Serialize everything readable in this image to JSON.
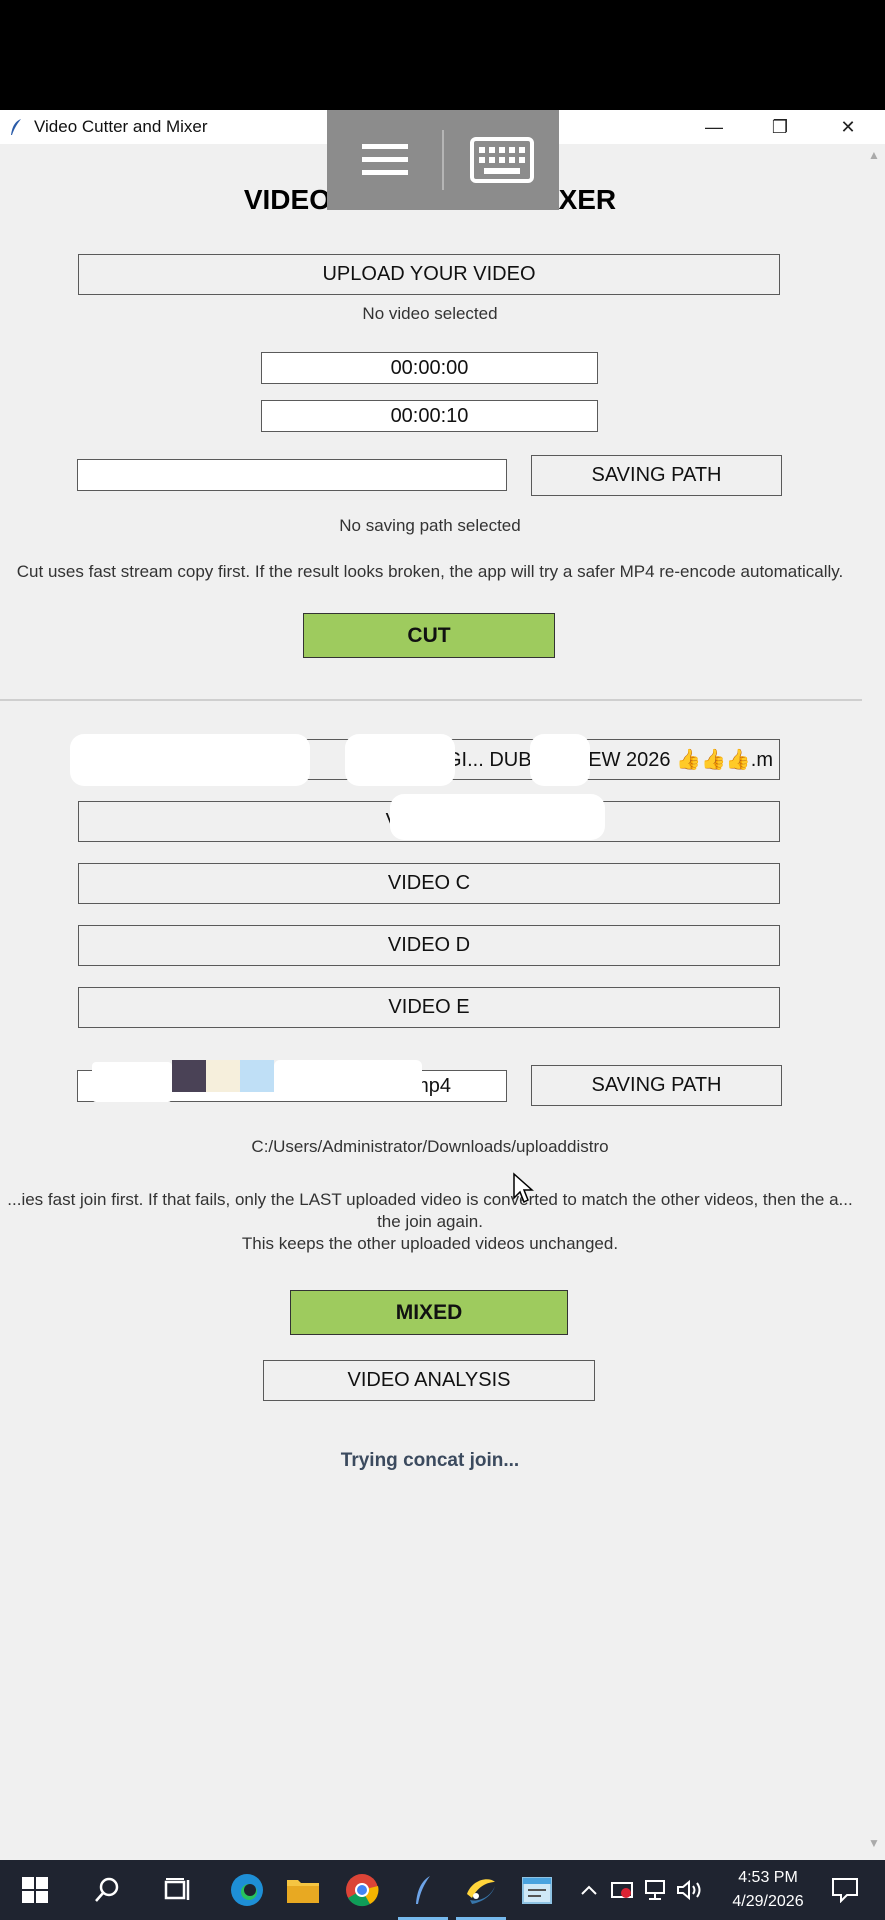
{
  "window": {
    "title": "Video Cutter and Mixer",
    "minimize_glyph": "—",
    "restore_glyph": "❐",
    "close_glyph": "✕"
  },
  "cutter": {
    "heading": "VIDEO CUTTER AND MIXER",
    "upload_label": "UPLOAD YOUR VIDEO",
    "upload_status": "No video selected",
    "start_time": "00:00:00",
    "end_time": "00:00:10",
    "saving_path_value": "",
    "saving_path_button": "SAVING PATH",
    "saving_path_status": "No saving path selected",
    "hint": "Cut uses fast stream copy first. If the result looks broken, the app will try a safer MP4 re-encode automatically.",
    "cut_button": "CUT"
  },
  "mixer": {
    "video_a_label": "...AGI...  DUB A...  ...EW 2026 👍👍👍.m",
    "video_b_label": "VIDEO B:",
    "video_c_label": "VIDEO C",
    "video_d_label": "VIDEO D",
    "video_e_label": "VIDEO E",
    "output_name": "...adcn mag...mp4",
    "saving_path_button": "SAVING PATH",
    "saving_path_status": "C:/Users/Administrator/Downloads/uploaddistro",
    "hint_line1": "...ies fast join first. If that fails, only the LAST uploaded video is converted to match the other videos, then the a...",
    "hint_line2": "the join again.",
    "hint_line3": "This keeps the other uploaded videos unchanged.",
    "mixed_button": "MIXED",
    "analysis_button": "VIDEO ANALYSIS",
    "status": "Trying concat join..."
  },
  "taskbar": {
    "time": "4:53 PM",
    "date": "4/29/2026"
  },
  "colors": {
    "accent_green": "#9ecb5e",
    "status_text": "#3b4a5e",
    "taskbar": "#1f2430"
  }
}
